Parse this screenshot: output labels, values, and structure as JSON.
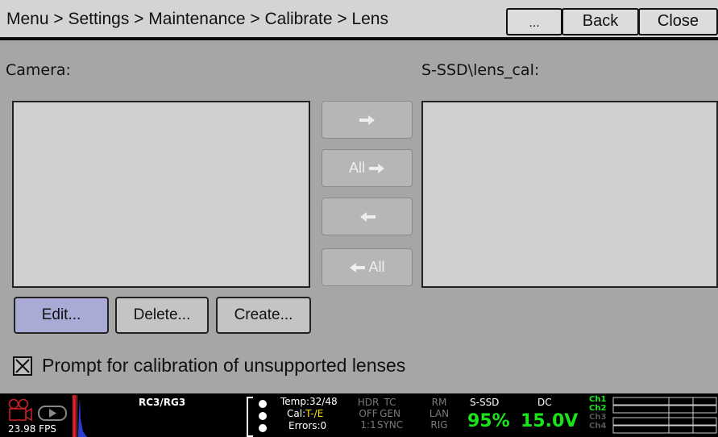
{
  "header": {
    "breadcrumb": "Menu > Settings > Maintenance > Calibrate > Lens",
    "more_label": "...",
    "back_label": "Back",
    "close_label": "Close"
  },
  "main": {
    "camera_label": "Camera:",
    "ssd_label": "S-SSD\\lens_cal:",
    "camera_items": [],
    "ssd_items": [],
    "transfer": {
      "right_icon": "arrow-right-icon",
      "all_right_label": "All",
      "left_icon": "arrow-left-icon",
      "all_left_label": "All"
    },
    "buttons": {
      "edit": "Edit...",
      "delete": "Delete...",
      "create": "Create..."
    },
    "prompt": {
      "checked": true,
      "label": "Prompt for calibration of unsupported lenses"
    }
  },
  "status": {
    "fps": "23.98 FPS",
    "rc": "RC3/RG3",
    "temp": "Temp:32/48",
    "cal_prefix": "Cal:",
    "cal_value": "T-/E",
    "errors": "Errors:0",
    "hdr": [
      "HDR",
      "OFF",
      "1:1"
    ],
    "tc": [
      "TC",
      "GEN",
      "SYNC"
    ],
    "rm": [
      "RM",
      "LAN",
      "RIG"
    ],
    "media_title": "S-SSD",
    "media_pct": "95%",
    "dc_title": "DC",
    "dc_value": "15.0V",
    "channels": [
      "Ch1",
      "Ch2",
      "Ch3",
      "Ch4"
    ],
    "colors": {
      "active": "#19e619",
      "inactive": "#555555",
      "highlight": "#ffe100",
      "record": "#d0202a"
    }
  }
}
